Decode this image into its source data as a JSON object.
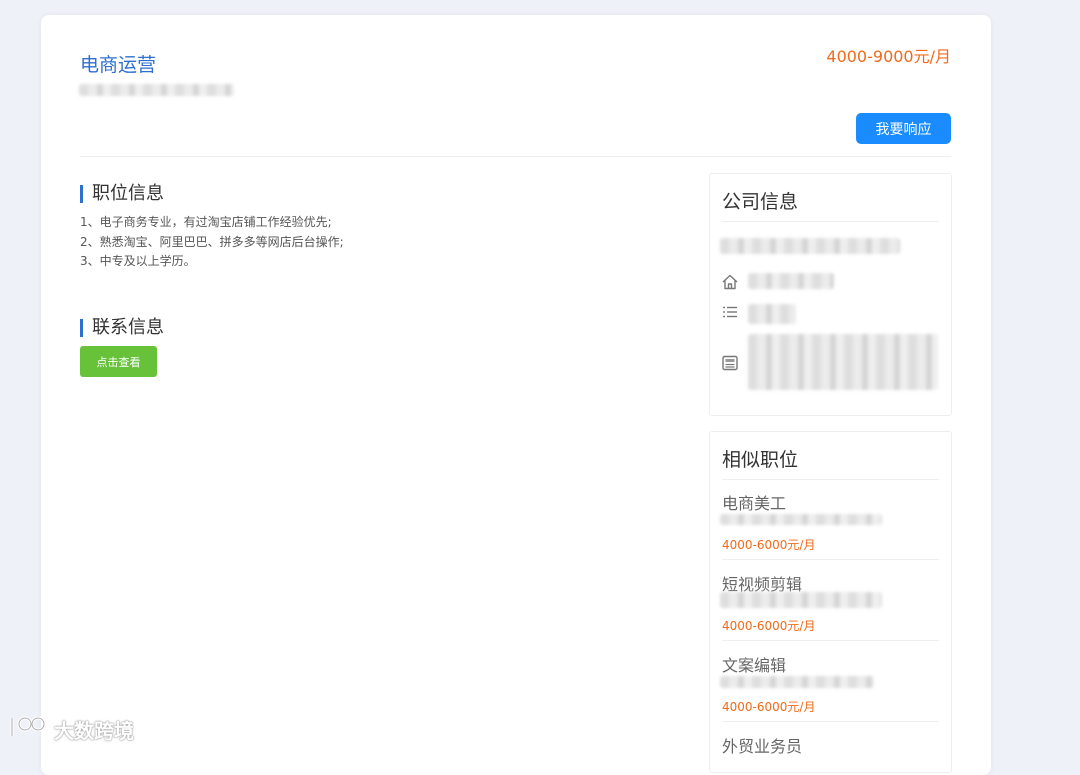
{
  "job": {
    "title": "电商运营",
    "salary": "4000-9000元/月",
    "respond_label": "我要响应"
  },
  "position_info": {
    "heading": "职位信息",
    "requirements": [
      "1、电子商务专业，有过淘宝店铺工作经验优先;",
      "2、熟悉淘宝、阿里巴巴、拼多多等网店后台操作;",
      "3、中专及以上学历。"
    ]
  },
  "contact_info": {
    "heading": "联系信息",
    "view_label": "点击查看"
  },
  "company_info": {
    "heading": "公司信息",
    "icons": [
      "home-icon",
      "list-icon",
      "newspaper-icon"
    ]
  },
  "similar_jobs": {
    "heading": "相似职位",
    "items": [
      {
        "title": "电商美工",
        "salary": "4000-6000元/月"
      },
      {
        "title": "短视频剪辑",
        "salary": "4000-6000元/月"
      },
      {
        "title": "文案编辑",
        "salary": "4000-6000元/月"
      },
      {
        "title": "外贸业务员"
      }
    ]
  },
  "watermark": {
    "text": "大数跨境"
  },
  "colors": {
    "accent_blue": "#2f6fd0",
    "button_blue": "#1a8cff",
    "button_green": "#67c23a",
    "salary_orange": "#f06b1b",
    "page_bg": "#eef1f7"
  }
}
